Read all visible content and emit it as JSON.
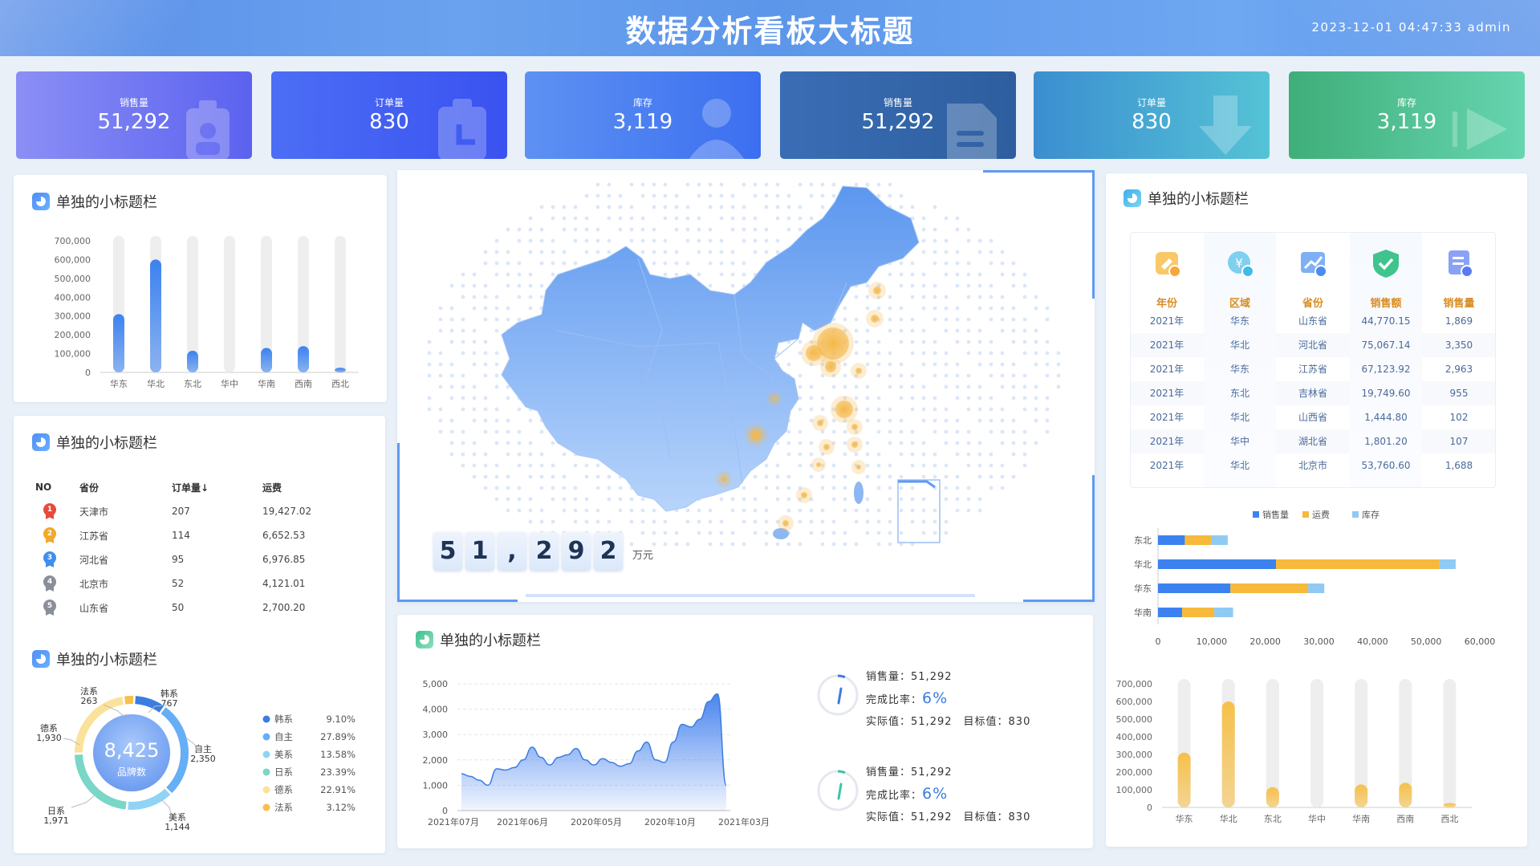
{
  "header": {
    "title": "数据分析看板大标题",
    "datetime": "2023-12-01 04:47:33 admin"
  },
  "kpis": [
    {
      "label": "销售量",
      "value": "51,292",
      "icon": "badge-icon",
      "color1": "#8b8ff5",
      "color2": "#5b62ef"
    },
    {
      "label": "订单量",
      "value": "830",
      "icon": "clipboard-icon",
      "color1": "#4c6ef5",
      "color2": "#3a52f0"
    },
    {
      "label": "库存",
      "value": "3,119",
      "icon": "user-icon",
      "color1": "#5e91f2",
      "color2": "#3b6ff0"
    },
    {
      "label": "销售量",
      "value": "51,292",
      "icon": "document-icon",
      "color1": "#3a6db5",
      "color2": "#2d5e9e"
    },
    {
      "label": "订单量",
      "value": "830",
      "icon": "download-icon",
      "color1": "#3b8ed0",
      "color2": "#55c3d6"
    },
    {
      "label": "库存",
      "value": "3,119",
      "icon": "play-icon",
      "color1": "#3fae79",
      "color2": "#66d5b0"
    }
  ],
  "panels": {
    "bar_left_title": "单独的小标题栏",
    "rank_title": "单独的小标题栏",
    "donut_title": "单独的小标题栏",
    "table_title": "单独的小标题栏",
    "area_title": "单独的小标题栏"
  },
  "bar_left": {
    "type": "bar",
    "categories": [
      "华东",
      "华北",
      "东北",
      "华中",
      "华南",
      "西南",
      "西北"
    ],
    "values": [
      310000,
      600000,
      115000,
      0,
      130000,
      140000,
      25000
    ],
    "ylim": [
      0,
      700000
    ],
    "yticks": [
      "700,000",
      "600,000",
      "500,000",
      "400,000",
      "300,000",
      "200,000",
      "100,000",
      "0"
    ],
    "color": "#3b82f0"
  },
  "rank": {
    "headers": [
      "NO",
      "省份",
      "订单量↓",
      "运费"
    ],
    "rows": [
      {
        "no": "1",
        "province": "天津市",
        "orders": "207",
        "freight": "19,427.02",
        "color": "#e84a3c"
      },
      {
        "no": "2",
        "province": "江苏省",
        "orders": "114",
        "freight": "6,652.53",
        "color": "#f0a928"
      },
      {
        "no": "3",
        "province": "河北省",
        "orders": "95",
        "freight": "6,976.85",
        "color": "#3f8ef0"
      },
      {
        "no": "4",
        "province": "北京市",
        "orders": "52",
        "freight": "4,121.01",
        "color": "#8a8f99"
      },
      {
        "no": "5",
        "province": "山东省",
        "orders": "50",
        "freight": "2,700.20",
        "color": "#8a8f99"
      }
    ]
  },
  "donut": {
    "center_value": "8,425",
    "center_label": "品牌数",
    "segments": [
      {
        "name": "韩系",
        "value": 767,
        "pct": "9.10%",
        "color": "#3b7de0"
      },
      {
        "name": "自主",
        "value": 2350,
        "pct": "27.89%",
        "color": "#66aef5"
      },
      {
        "name": "美系",
        "value": 1144,
        "pct": "13.58%",
        "color": "#8fd4f5"
      },
      {
        "name": "日系",
        "value": 1971,
        "pct": "23.39%",
        "color": "#7ad6c6"
      },
      {
        "name": "德系",
        "value": 1930,
        "pct": "22.91%",
        "color": "#fbe29a"
      },
      {
        "name": "法系",
        "value": 263,
        "pct": "3.12%",
        "color": "#f6c04a"
      }
    ],
    "callouts": [
      {
        "name": "法系",
        "value": "263"
      },
      {
        "name": "韩系",
        "value": "767"
      },
      {
        "name": "自主",
        "value": "2,350"
      },
      {
        "name": "美系",
        "value": "1,144"
      },
      {
        "name": "日系",
        "value": "1,971"
      },
      {
        "name": "德系",
        "value": "1,930"
      }
    ]
  },
  "map": {
    "counter_digits": [
      "5",
      "1",
      ",",
      "2",
      "9",
      "2"
    ],
    "counter_unit": "万元"
  },
  "table": {
    "headers": [
      {
        "label": "年份",
        "icon": "calendar-icon",
        "color": "#f4a73b"
      },
      {
        "label": "区域",
        "icon": "yuan-icon",
        "color": "#3fbbe8"
      },
      {
        "label": "省份",
        "icon": "trend-icon",
        "color": "#4a8cf0"
      },
      {
        "label": "销售额",
        "icon": "shield-check-icon",
        "color": "#3ec48c"
      },
      {
        "label": "销售量",
        "icon": "list-check-icon",
        "color": "#5b7bf0"
      }
    ],
    "rows": [
      [
        "2021年",
        "华东",
        "山东省",
        "44,770.15",
        "1,869"
      ],
      [
        "2021年",
        "华北",
        "河北省",
        "75,067.14",
        "3,350"
      ],
      [
        "2021年",
        "华东",
        "江苏省",
        "67,123.92",
        "2,963"
      ],
      [
        "2021年",
        "东北",
        "吉林省",
        "19,749.60",
        "955"
      ],
      [
        "2021年",
        "华北",
        "山西省",
        "1,444.80",
        "102"
      ],
      [
        "2021年",
        "华中",
        "湖北省",
        "1,801.20",
        "107"
      ],
      [
        "2021年",
        "华北",
        "北京市",
        "53,760.60",
        "1,688"
      ]
    ]
  },
  "hbar": {
    "type": "bar",
    "legend": [
      {
        "name": "销售量",
        "color": "#3b82f0"
      },
      {
        "name": "运费",
        "color": "#f6b93b"
      },
      {
        "name": "库存",
        "color": "#8fcaf5"
      }
    ],
    "categories": [
      "东北",
      "华北",
      "华东",
      "华南"
    ],
    "series": [
      {
        "name": "销售量",
        "values": [
          5000,
          22000,
          13500,
          4500
        ]
      },
      {
        "name": "运费",
        "values": [
          5000,
          30500,
          14500,
          6000
        ]
      },
      {
        "name": "库存",
        "values": [
          3000,
          3000,
          3000,
          3500
        ]
      }
    ],
    "xlim": [
      0,
      60000
    ],
    "xticks": [
      "0",
      "10,000",
      "20,000",
      "30,000",
      "40,000",
      "50,000",
      "60,000"
    ]
  },
  "bar_right": {
    "type": "bar",
    "categories": [
      "华东",
      "华北",
      "东北",
      "华中",
      "华南",
      "西南",
      "西北"
    ],
    "values": [
      310000,
      600000,
      115000,
      0,
      130000,
      140000,
      25000
    ],
    "ylim": [
      0,
      700000
    ],
    "yticks": [
      "700,000",
      "600,000",
      "500,000",
      "400,000",
      "300,000",
      "200,000",
      "100,000",
      "0"
    ],
    "color": "#f6c04a"
  },
  "area": {
    "type": "area",
    "x_labels": [
      "2021年07月",
      "2021年06月",
      "2020年05月",
      "2020年10月",
      "2021年03月"
    ],
    "yticks": [
      "5,000",
      "4,000",
      "3,000",
      "2,000",
      "1,000",
      "0"
    ],
    "ylim": [
      0,
      5000
    ],
    "values": [
      1450,
      1350,
      1200,
      1000,
      1650,
      1600,
      1700,
      2000,
      2500,
      2100,
      1800,
      2100,
      2200,
      2450,
      2000,
      1800,
      2050,
      1900,
      1750,
      1850,
      2350,
      2700,
      2000,
      1900,
      2700,
      3400,
      3300,
      3600,
      4300,
      4600,
      1000
    ]
  },
  "gauges": [
    {
      "sales_label": "销售量：",
      "sales_value": "51,292",
      "ratio_label": "完成比率：",
      "ratio_value": "6%",
      "actual_label": "实际值：",
      "actual_value": "51,292",
      "target_label": "目标值：",
      "target_value": "830",
      "percent": 0.06,
      "color": "#3b7de0"
    },
    {
      "sales_label": "销售量：",
      "sales_value": "51,292",
      "ratio_label": "完成比率：",
      "ratio_value": "6%",
      "actual_label": "实际值：",
      "actual_value": "51,292",
      "target_label": "目标值：",
      "target_value": "830",
      "percent": 0.06,
      "color": "#3ec4a4"
    }
  ]
}
